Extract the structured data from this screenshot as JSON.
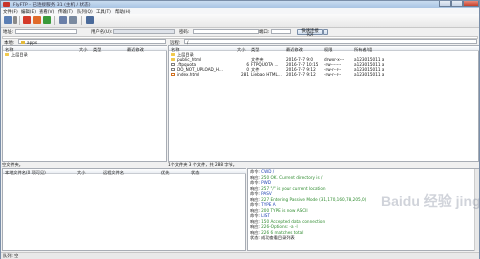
{
  "window": {
    "title": "FlyFTP - 已连接服务 31 (主机 / 状态)"
  },
  "menu": [
    "文件(F)",
    "编辑(E)",
    "查看(V)",
    "传输(T)",
    "队列(Q)",
    "工具(T)",
    "帮助(H)"
  ],
  "toolbar": {
    "icons": [
      "connect-icon",
      "dropdown-icon",
      "disconnect-icon",
      "stop-icon",
      "refresh-icon",
      "sync-icon",
      "compare-icon",
      "filter-icon"
    ]
  },
  "quickconnect": {
    "host_label": "地址:",
    "host_value": "",
    "user_label": "用户名(U):",
    "user_value": "",
    "pass_label": "密码:",
    "pass_value": "",
    "port_label": "端口:",
    "port_value": "",
    "connect_button": "快速连接(Q)"
  },
  "local": {
    "path_label": "本地:",
    "path_value": "apps",
    "headers": [
      "名称",
      "大小",
      "类型",
      "最近修改"
    ],
    "items": [
      {
        "name": "上层目录",
        "size": "",
        "type": "",
        "modified": ""
      }
    ],
    "status": "空文件夹。"
  },
  "remote": {
    "path_label": "远程:",
    "path_value": "/",
    "headers": [
      "名称",
      "大小",
      "类型",
      "最近修改",
      "权限",
      "所有者/组"
    ],
    "items": [
      {
        "name": "上层目录",
        "size": "",
        "type": "",
        "modified": "",
        "perms": "",
        "owner": "",
        "icon": "folder"
      },
      {
        "name": "public_html",
        "size": "",
        "type": "文件夹",
        "modified": "2016-7-7 9:0",
        "perms": "drwxr-x---",
        "owner": "a123015011 a",
        "icon": "folder"
      },
      {
        "name": ".ftpquota",
        "size": "6",
        "type": "FTPQUOTA ...",
        "modified": "2016-7-7 10:15",
        "perms": "-rw-------",
        "owner": "a123015011 a",
        "icon": "doc"
      },
      {
        "name": "DO_NOT_UPLOAD_H...",
        "size": "0",
        "type": "文件",
        "modified": "2016-7-7 9:12",
        "perms": "-rw-r--r--",
        "owner": "a123015011 a",
        "icon": "doc"
      },
      {
        "name": "index.html",
        "size": "281",
        "type": "Liebao HTML...",
        "modified": "2016-7-7 9:12",
        "perms": "-rw-r--r--",
        "owner": "a123015011 a",
        "icon": "doc"
      }
    ],
    "status": "1个文件夹 3 个文件，共 288 字节。"
  },
  "queue": {
    "headers": [
      "本地文件名(0 项可见)",
      "大小",
      "远程文件名",
      "优先",
      "状态"
    ]
  },
  "log": {
    "lines": [
      {
        "tag": "命令:",
        "text": "CWD /",
        "color": "#1a3fb0"
      },
      {
        "tag": "响应:",
        "text": "250 OK. Current directory is /",
        "color": "#2e8b2e"
      },
      {
        "tag": "命令:",
        "text": "PWD",
        "color": "#1a3fb0"
      },
      {
        "tag": "响应:",
        "text": "257 \"/\" is your current location",
        "color": "#2e8b2e"
      },
      {
        "tag": "命令:",
        "text": "PASV",
        "color": "#1a3fb0"
      },
      {
        "tag": "响应:",
        "text": "227 Entering Passive Mode (31,170,160,78,205,0)",
        "color": "#2e8b2e"
      },
      {
        "tag": "命令:",
        "text": "TYPE A",
        "color": "#1a3fb0"
      },
      {
        "tag": "响应:",
        "text": "200 TYPE is now ASCII",
        "color": "#2e8b2e"
      },
      {
        "tag": "命令:",
        "text": "LIST",
        "color": "#1a3fb0"
      },
      {
        "tag": "响应:",
        "text": "150 Accepted data connection",
        "color": "#2e8b2e"
      },
      {
        "tag": "响应:",
        "text": "226-Options: -a -l",
        "color": "#2e8b2e"
      },
      {
        "tag": "响应:",
        "text": "226 6 matches total",
        "color": "#2e8b2e"
      },
      {
        "tag": "状态:",
        "text": "成功查看目录列表",
        "color": "#111111"
      }
    ]
  },
  "statusbar": {
    "queue": "队列: 空"
  },
  "watermark": "Baidu 经验 jingyan.baidu.com"
}
